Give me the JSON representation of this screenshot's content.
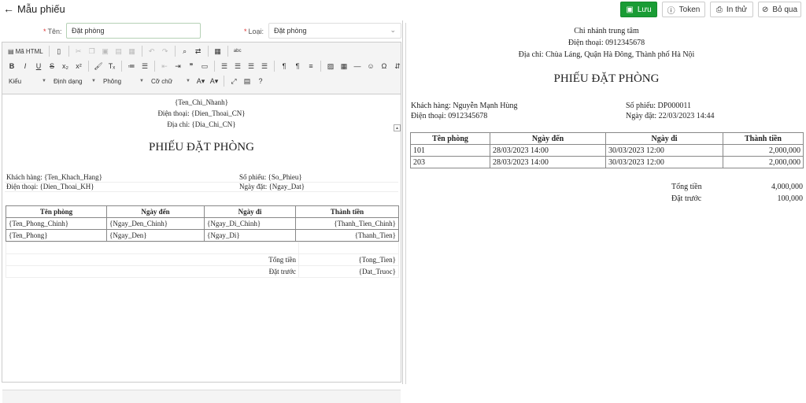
{
  "header": {
    "back_label": "Mẫu phiếu",
    "save_label": "Lưu",
    "token_label": "Token",
    "print_label": "In thử",
    "skip_label": "Bỏ qua"
  },
  "form": {
    "name_label": "Tên:",
    "name_value": "Đặt phòng",
    "type_label": "Loại:",
    "type_value": "Đặt phòng"
  },
  "toolbar": {
    "source_label": "Mã HTML",
    "style_label": "Kiểu",
    "format_label": "Định dạng",
    "font_label": "Phông",
    "size_label": "Cỡ chữ"
  },
  "template_doc": {
    "branch": "{Ten_Chi_Nhanh}",
    "phone": "Điện thoại: {Dien_Thoai_CN}",
    "address": "Địa chỉ: {Dia_Chi_CN}",
    "title": "PHIẾU ĐẶT PHÒNG",
    "customer": "Khách hàng: {Ten_Khach_Hang}",
    "receipt_no": "Số phiếu: {So_Phieu}",
    "customer_phone": "Điện thoại: {Dien_Thoai_KH}",
    "order_date": "Ngày đặt: {Ngay_Dat}",
    "columns": [
      "Tên phòng",
      "Ngày đến",
      "Ngày đi",
      "Thành tiền"
    ],
    "rows": [
      [
        "{Ten_Phong_Chinh}",
        "{Ngay_Den_Chinh}",
        "{Ngay_Di_Chinh}",
        "{Thanh_Tien_Chinh}"
      ],
      [
        "{Ten_Phong}",
        "{Ngay_Den}",
        "{Ngay_Di}",
        "{Thanh_Tien}"
      ]
    ],
    "total_label": "Tổng tiền",
    "total_value": "{Tong_Tien}",
    "deposit_label": "Đặt trước",
    "deposit_value": "{Dat_Truoc}"
  },
  "preview": {
    "branch": "Chi nhánh trung tâm",
    "phone": "Điện thoại: 0912345678",
    "address": "Địa chỉ: Chùa Láng, Quận Hà Đông, Thành phố Hà Nội",
    "title": "PHIẾU ĐẶT PHÒNG",
    "customer": "Khách hàng: Nguyễn Mạnh Hùng",
    "receipt_no": "Số phiếu: DP000011",
    "customer_phone": "Điện thoại: 0912345678",
    "order_date": "Ngày đặt: 22/03/2023 14:44",
    "columns": [
      "Tên phòng",
      "Ngày đến",
      "Ngày đi",
      "Thành tiền"
    ],
    "rows": [
      [
        "101",
        "28/03/2023 14:00",
        "30/03/2023 12:00",
        "2,000,000"
      ],
      [
        "203",
        "28/03/2023 14:00",
        "30/03/2023 12:00",
        "2,000,000"
      ]
    ],
    "total_label": "Tổng tiền",
    "total_value": "4,000,000",
    "deposit_label": "Đặt trước",
    "deposit_value": "100,000"
  },
  "colors": {
    "primary_button": "#1a9c35",
    "input_border": "#b5d1b5",
    "required_marker": "#d33"
  }
}
